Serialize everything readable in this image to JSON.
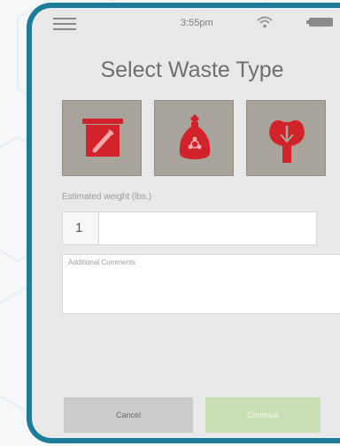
{
  "status_bar": {
    "time": "3:55pm",
    "icons": [
      "menu-icon",
      "wifi-icon",
      "battery-icon"
    ]
  },
  "page": {
    "title": "Select Waste Type"
  },
  "waste_types": [
    {
      "icon": "sharps-container-icon",
      "color": "#d2232a"
    },
    {
      "icon": "biohazard-bag-icon",
      "color": "#d2232a"
    },
    {
      "icon": "anatomical-waste-icon",
      "color": "#d2232a"
    }
  ],
  "form": {
    "weight_label": "Estimated weight (lbs.)",
    "weight_value": "1",
    "comments_placeholder": "Additional Comments"
  },
  "actions": {
    "cancel_label": "Cancel",
    "continue_label": "Continue"
  },
  "colors": {
    "frame": "#1c7d98",
    "screen_bg": "#e9e9e9",
    "tile_bg": "#a8a49b",
    "icon_red": "#d2232a",
    "cancel_bg": "#cbcbcb",
    "continue_bg": "#c8e0b4"
  }
}
